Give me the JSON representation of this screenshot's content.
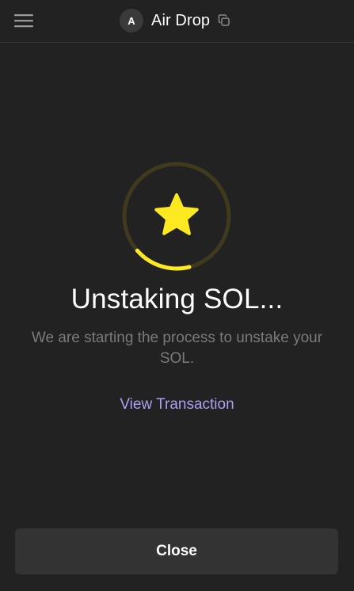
{
  "header": {
    "menu_icon": "hamburger-menu-icon",
    "avatar_initial": "A",
    "account_name": "Air Drop",
    "copy_icon": "copy-icon"
  },
  "status": {
    "icon": "star-icon",
    "title": "Unstaking SOL...",
    "message": "We are starting the process to unstake your SOL.",
    "view_transaction_label": "View Transaction"
  },
  "footer": {
    "close_label": "Close"
  },
  "colors": {
    "background": "#222222",
    "accent_yellow": "#ffe920",
    "link_purple": "#ab9ff2",
    "muted_text": "#7a7a7a",
    "button_bg": "#333333"
  }
}
